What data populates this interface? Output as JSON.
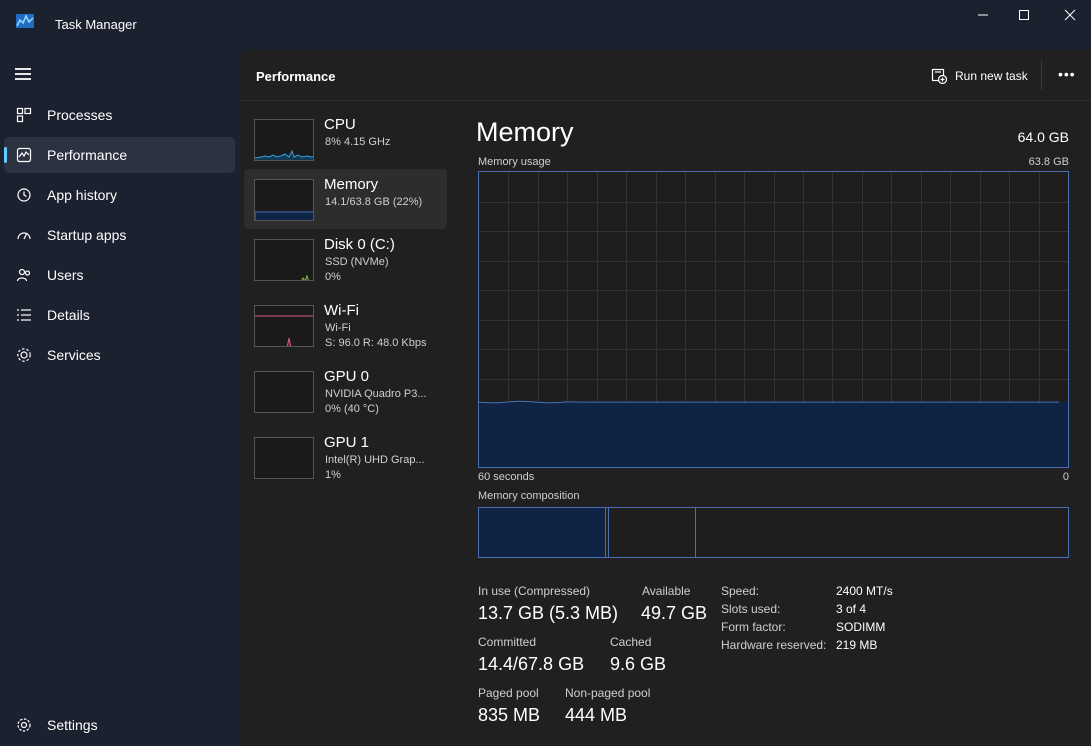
{
  "window": {
    "title": "Task Manager",
    "minimize": "—",
    "maximize": "☐",
    "close": "✕"
  },
  "nav": {
    "items": [
      {
        "label": "Processes",
        "icon": "processes-icon"
      },
      {
        "label": "Performance",
        "icon": "performance-icon"
      },
      {
        "label": "App history",
        "icon": "history-icon"
      },
      {
        "label": "Startup apps",
        "icon": "startup-icon"
      },
      {
        "label": "Users",
        "icon": "users-icon"
      },
      {
        "label": "Details",
        "icon": "details-icon"
      },
      {
        "label": "Services",
        "icon": "services-icon"
      }
    ],
    "settings": "Settings",
    "active": "Performance"
  },
  "header": {
    "title": "Performance",
    "run_new_task": "Run new task",
    "more": "•••"
  },
  "resources": [
    {
      "name": "CPU",
      "sub1": "8% 4.15 GHz",
      "sub2": ""
    },
    {
      "name": "Memory",
      "sub1": "14.1/63.8 GB (22%)",
      "sub2": ""
    },
    {
      "name": "Disk 0 (C:)",
      "sub1": "SSD (NVMe)",
      "sub2": "0%"
    },
    {
      "name": "Wi-Fi",
      "sub1": "Wi-Fi",
      "sub2": "S: 96.0 R: 48.0 Kbps"
    },
    {
      "name": "GPU 0",
      "sub1": "NVIDIA Quadro P3...",
      "sub2": "0% (40 °C)"
    },
    {
      "name": "GPU 1",
      "sub1": "Intel(R) UHD Grap...",
      "sub2": "1%"
    }
  ],
  "memory": {
    "title": "Memory",
    "total": "64.0 GB",
    "usage_label": "Memory usage",
    "usage_max": "63.8 GB",
    "time_left": "60 seconds",
    "time_right": "0",
    "composition_label": "Memory composition",
    "usage_fraction": 0.22,
    "stats": {
      "in_use_label": "In use (Compressed)",
      "in_use_value": "13.7 GB (5.3 MB)",
      "available_label": "Available",
      "available_value": "49.7 GB",
      "committed_label": "Committed",
      "committed_value": "14.4/67.8 GB",
      "cached_label": "Cached",
      "cached_value": "9.6 GB",
      "paged_label": "Paged pool",
      "paged_value": "835 MB",
      "nonpaged_label": "Non-paged pool",
      "nonpaged_value": "444 MB"
    },
    "specs": {
      "speed_label": "Speed:",
      "speed_value": "2400 MT/s",
      "slots_label": "Slots used:",
      "slots_value": "3 of 4",
      "form_label": "Form factor:",
      "form_value": "SODIMM",
      "hw_label": "Hardware reserved:",
      "hw_value": "219 MB"
    }
  },
  "colors": {
    "accent": "#60cdff",
    "memory_line": "#4a6fb5",
    "memory_fill": "#0f2444",
    "cpu_line": "#3aa0d8",
    "disk_line": "#8ab84a",
    "wifi_line": "#d95a8a"
  }
}
